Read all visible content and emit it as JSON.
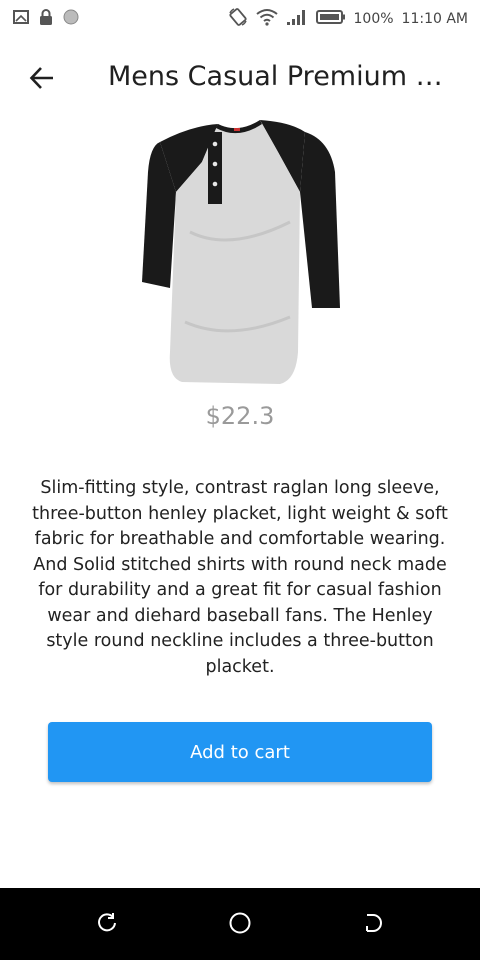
{
  "status_bar": {
    "battery_text": "100%",
    "time": "11:10 AM",
    "icons": [
      "screenshot-icon",
      "lock-icon",
      "circle-icon",
      "rotate-icon",
      "wifi-icon",
      "signal-icon",
      "battery-icon"
    ]
  },
  "app_bar": {
    "back_icon": "arrow-left-icon",
    "title": "Mens Casual Premium Slim Fit T-Shirts"
  },
  "product": {
    "image_icon": "henley-shirt-image",
    "price": "$22.3",
    "description": "Slim-fitting style, contrast raglan long sleeve, three-button henley placket, light weight & soft fabric for breathable and comfortable wearing. And Solid stitched shirts with round neck made for durability and a great fit for casual fashion wear and diehard baseball fans. The Henley style round neckline includes a three-button placket."
  },
  "actions": {
    "add_to_cart_label": "Add to cart"
  },
  "nav_bar": {
    "icons": [
      "recents-icon",
      "home-icon",
      "back-nav-icon"
    ]
  },
  "colors": {
    "accent": "#2196f3",
    "price": "#9a9a9a",
    "nav_bg": "#000000"
  }
}
